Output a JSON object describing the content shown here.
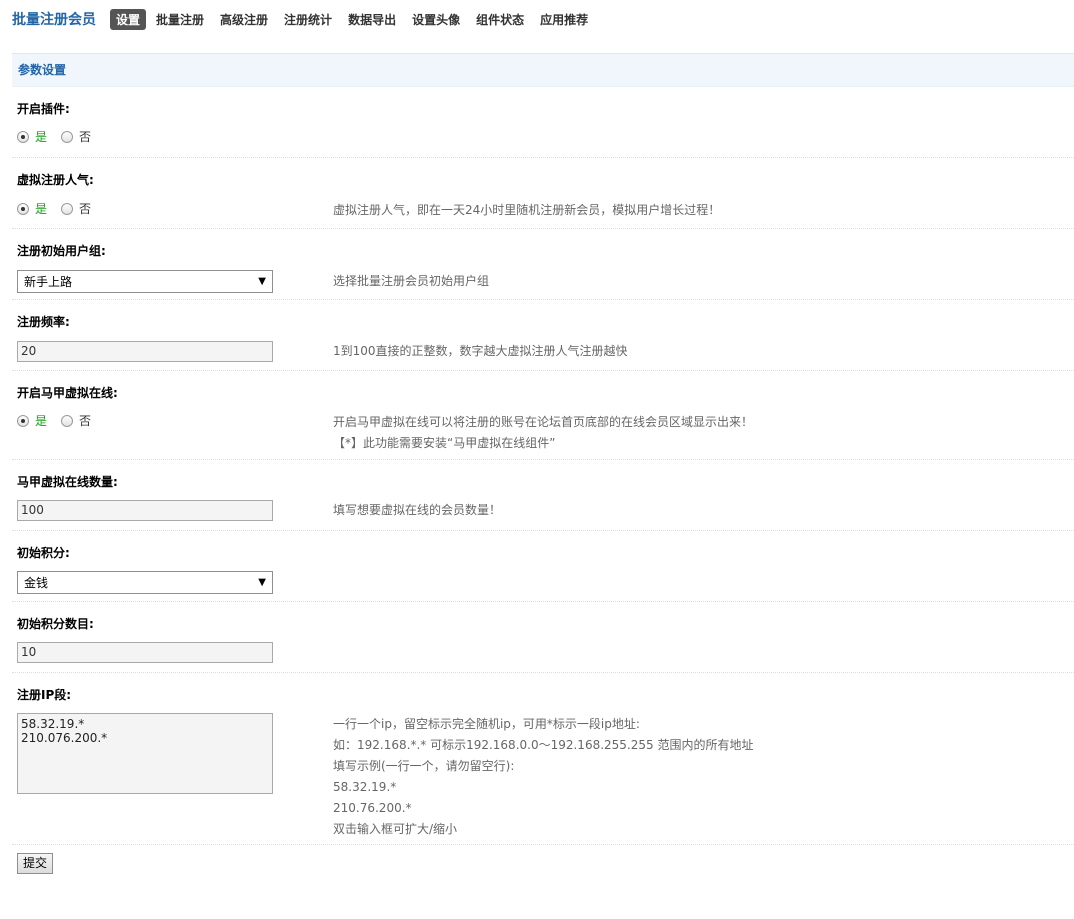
{
  "header": {
    "brand": "批量注册会员",
    "nav": [
      {
        "label": "设置",
        "active": true
      },
      {
        "label": "批量注册"
      },
      {
        "label": "高级注册"
      },
      {
        "label": "注册统计"
      },
      {
        "label": "数据导出"
      },
      {
        "label": "设置头像"
      },
      {
        "label": "组件状态"
      },
      {
        "label": "应用推荐"
      }
    ]
  },
  "section": {
    "title": "参数设置"
  },
  "fields": {
    "enable_plugin": {
      "title": "开启插件:",
      "yes": "是",
      "no": "否",
      "selected": "是"
    },
    "virtual_popularity": {
      "title": "虚拟注册人气:",
      "yes": "是",
      "no": "否",
      "selected": "是",
      "tip": "虚拟注册人气，即在一天24小时里随机注册新会员，模拟用户增长过程！"
    },
    "initial_group": {
      "title": "注册初始用户组:",
      "value": "新手上路",
      "tip": "选择批量注册会员初始用户组"
    },
    "frequency": {
      "title": "注册频率:",
      "value": "20",
      "tip": "1到100直接的正整数，数字越大虚拟注册人气注册越快"
    },
    "vest_online": {
      "title": "开启马甲虚拟在线:",
      "yes": "是",
      "no": "否",
      "selected": "是",
      "tip1": "开启马甲虚拟在线可以将注册的账号在论坛首页底部的在线会员区域显示出来！",
      "tip2": "【*】此功能需要安装“马甲虚拟在线组件”"
    },
    "vest_count": {
      "title": "马甲虚拟在线数量:",
      "value": "100",
      "tip": "填写想要虚拟在线的会员数量！"
    },
    "initial_credit": {
      "title": "初始积分:",
      "value": "金钱"
    },
    "initial_credit_amount": {
      "title": "初始积分数目:",
      "value": "10"
    },
    "ip_range": {
      "title": "注册IP段:",
      "value": "58.32.19.*\n210.076.200.*",
      "tips": [
        "一行一个ip，留空标示完全随机ip，可用*标示一段ip地址:",
        "如：192.168.*.* 可标示192.168.0.0～192.168.255.255 范围内的所有地址",
        "填写示例(一行一个，请勿留空行):",
        "58.32.19.*",
        "210.76.200.*",
        "双击输入框可扩大/缩小"
      ]
    }
  },
  "submit_label": "提交"
}
